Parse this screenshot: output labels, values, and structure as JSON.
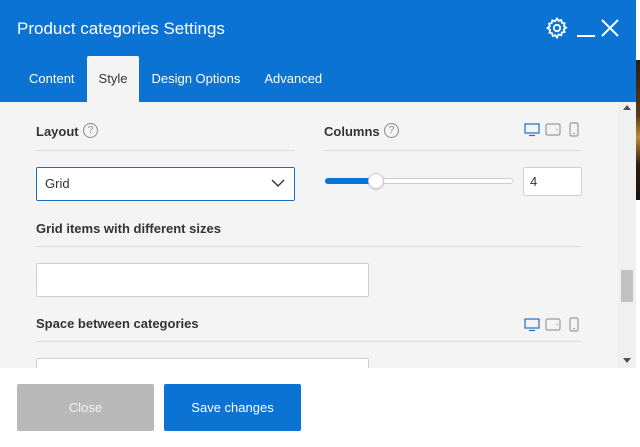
{
  "window": {
    "title": "Product categories Settings"
  },
  "header_icons": {
    "settings": "gear-icon",
    "minimize": "minimize-icon",
    "close": "close-icon"
  },
  "tabs": [
    {
      "label": "Content",
      "active": false
    },
    {
      "label": "Style",
      "active": true
    },
    {
      "label": "Design Options",
      "active": false
    },
    {
      "label": "Advanced",
      "active": false
    }
  ],
  "fields": {
    "layout": {
      "label": "Layout",
      "help": "?",
      "value": "Grid"
    },
    "columns": {
      "label": "Columns",
      "help": "?",
      "value": "4",
      "slider_fraction": 0.27
    },
    "grid_items": {
      "label": "Grid items with different sizes",
      "value": ""
    },
    "space_between": {
      "label": "Space between categories",
      "value": ""
    }
  },
  "device_icons": [
    "desktop-icon",
    "tablet-icon",
    "mobile-icon"
  ],
  "footer": {
    "close_label": "Close",
    "save_label": "Save changes"
  },
  "colors": {
    "accent": "#0a73d4",
    "panel_bg": "#f4f4f4",
    "disabled_button": "#b9b9b9"
  }
}
